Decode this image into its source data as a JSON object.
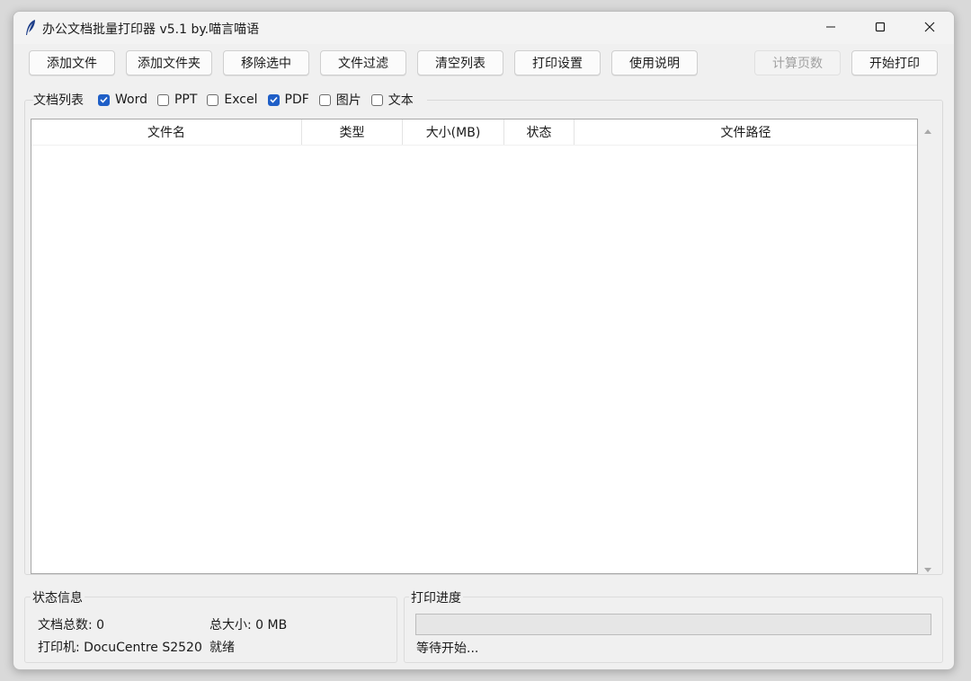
{
  "window": {
    "title": "办公文档批量打印器 v5.1 by.喵言喵语"
  },
  "toolbar": {
    "add_file": "添加文件",
    "add_folder": "添加文件夹",
    "remove_selected": "移除选中",
    "file_filter": "文件过滤",
    "clear_list": "清空列表",
    "print_settings": "打印设置",
    "usage_guide": "使用说明",
    "count_pages": "计算页数",
    "start_print": "开始打印"
  },
  "filters": {
    "label": "文档列表",
    "items": [
      {
        "label": "Word",
        "checked": true
      },
      {
        "label": "PPT",
        "checked": false
      },
      {
        "label": "Excel",
        "checked": false
      },
      {
        "label": "PDF",
        "checked": true
      },
      {
        "label": "图片",
        "checked": false
      },
      {
        "label": "文本",
        "checked": false
      }
    ]
  },
  "table": {
    "columns": [
      "文件名",
      "类型",
      "大小(MB)",
      "状态",
      "文件路径"
    ],
    "rows": []
  },
  "status_info": {
    "title": "状态信息",
    "doc_count": "文档总数: 0",
    "total_size": "总大小: 0 MB",
    "printer": "打印机: DocuCentre S2520",
    "state": "就绪"
  },
  "print_progress": {
    "title": "打印进度",
    "progress": 0,
    "message": "等待开始..."
  },
  "colors": {
    "checkbox_accent": "#1f5fc7",
    "window_bg": "#f0f0f0"
  }
}
